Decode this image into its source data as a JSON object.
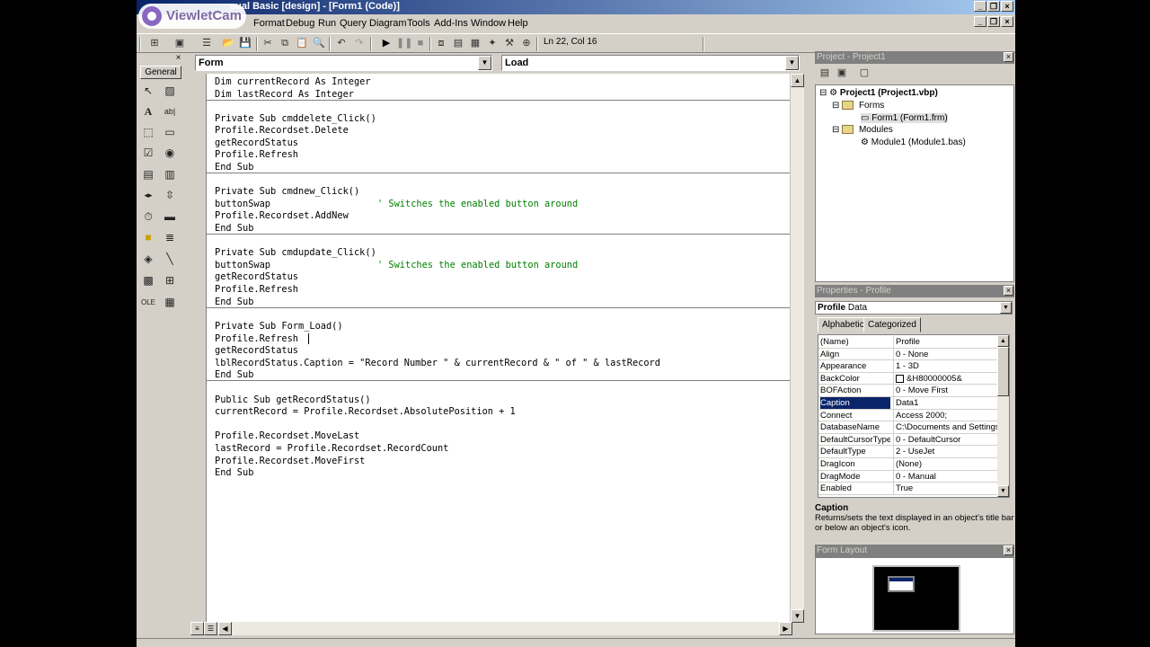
{
  "title": "Microsoft Visual Basic [design] - [Form1 (Code)]",
  "visible_title": "sual Basic [design] - [Form1 (Code)]",
  "watermark": "ViewletCam",
  "menu": [
    "Format",
    "Debug",
    "Run",
    "Query",
    "Diagram",
    "Tools",
    "Add-Ins",
    "Window",
    "Help"
  ],
  "toolbar": {
    "position": "Ln 22, Col 16"
  },
  "toolbox": {
    "tab": "General"
  },
  "code": {
    "object_combo": "Form",
    "proc_combo": "Load",
    "lines": [
      {
        "t": "Dim currentRecord As Integer"
      },
      {
        "t": "Dim lastRecord As Integer"
      },
      {
        "t": "Private Sub cmddelete_Click()"
      },
      {
        "t": "Profile.Recordset.Delete"
      },
      {
        "t": "getRecordStatus"
      },
      {
        "t": "Profile.Refresh"
      },
      {
        "t": "End Sub"
      },
      {
        "t": "Private Sub cmdnew_Click()"
      },
      {
        "t": "buttonSwap",
        "c": "' Switches the enabled button around"
      },
      {
        "t": "Profile.Recordset.AddNew"
      },
      {
        "t": "End Sub"
      },
      {
        "t": "Private Sub cmdupdate_Click()"
      },
      {
        "t": "buttonSwap",
        "c": "' Switches the enabled button around"
      },
      {
        "t": "getRecordStatus"
      },
      {
        "t": "Profile.Refresh"
      },
      {
        "t": "End Sub"
      },
      {
        "t": "Private Sub Form_Load()"
      },
      {
        "t": "Profile.Refresh"
      },
      {
        "t": "getRecordStatus"
      },
      {
        "t": "lblRecordStatus.Caption = \"Record Number \" & currentRecord & \" of \" & lastRecord"
      },
      {
        "t": "End Sub"
      },
      {
        "t": "Public Sub getRecordStatus()"
      },
      {
        "t": "currentRecord = Profile.Recordset.AbsolutePosition + 1"
      },
      {
        "t": "Profile.Recordset.MoveLast"
      },
      {
        "t": "lastRecord = Profile.Recordset.RecordCount"
      },
      {
        "t": "Profile.Recordset.MoveFirst"
      },
      {
        "t": "End Sub"
      }
    ]
  },
  "project": {
    "title": "Project - Project1",
    "root": "Project1 (Project1.vbp)",
    "forms_folder": "Forms",
    "form1": "Form1 (Form1.frm)",
    "modules_folder": "Modules",
    "module1": "Module1 (Module1.bas)"
  },
  "properties": {
    "title": "Properties - Profile",
    "object": "Profile",
    "object_type": "Data",
    "tab_alpha": "Alphabetic",
    "tab_cat": "Categorized",
    "rows": [
      {
        "n": "(Name)",
        "v": "Profile"
      },
      {
        "n": "Align",
        "v": "0 - None"
      },
      {
        "n": "Appearance",
        "v": "1 - 3D"
      },
      {
        "n": "BackColor",
        "v": "&H80000005&"
      },
      {
        "n": "BOFAction",
        "v": "0 - Move First"
      },
      {
        "n": "Caption",
        "v": "Data1"
      },
      {
        "n": "Connect",
        "v": "Access 2000;"
      },
      {
        "n": "DatabaseName",
        "v": "C:\\Documents and Settings\\"
      },
      {
        "n": "DefaultCursorType",
        "v": "0 - DefaultCursor"
      },
      {
        "n": "DefaultType",
        "v": "2 - UseJet"
      },
      {
        "n": "DragIcon",
        "v": "(None)"
      },
      {
        "n": "DragMode",
        "v": "0 - Manual"
      },
      {
        "n": "Enabled",
        "v": "True"
      }
    ],
    "desc_title": "Caption",
    "desc_text": "Returns/sets the text displayed in an object's title bar or below an object's icon."
  },
  "form_layout": {
    "title": "Form Layout"
  }
}
